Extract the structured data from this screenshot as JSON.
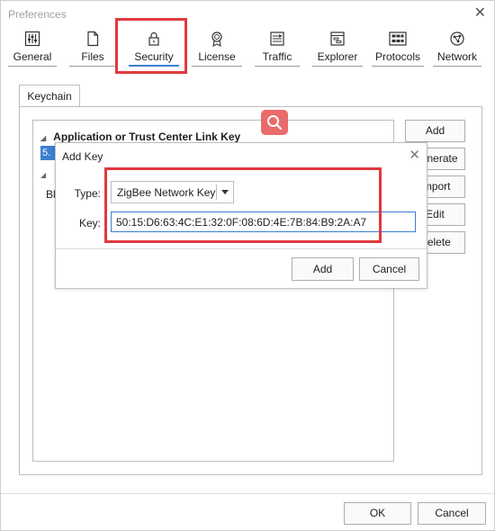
{
  "window": {
    "title": "Preferences"
  },
  "toolbar": [
    {
      "id": "general",
      "label": "General",
      "icon": "sliders-icon"
    },
    {
      "id": "files",
      "label": "Files",
      "icon": "file-icon"
    },
    {
      "id": "security",
      "label": "Security",
      "icon": "lock-icon",
      "active": true
    },
    {
      "id": "license",
      "label": "License",
      "icon": "award-icon"
    },
    {
      "id": "traffic",
      "label": "Traffic",
      "icon": "traffic-icon"
    },
    {
      "id": "explorer",
      "label": "Explorer",
      "icon": "explorer-icon"
    },
    {
      "id": "protocols",
      "label": "Protocols",
      "icon": "protocols-icon"
    },
    {
      "id": "network",
      "label": "Network",
      "icon": "network-icon"
    }
  ],
  "tabs": {
    "keychain": "Keychain"
  },
  "tree": {
    "group1": "Application or Trust Center Link Key",
    "item1_prefix": "5.",
    "item2_prefix": "Bl"
  },
  "side_buttons": {
    "add": "Add",
    "generate": "Generate",
    "import": "Import",
    "edit": "Edit",
    "delete": "Delete"
  },
  "dialog": {
    "title": "Add Key",
    "type_label": "Type:",
    "type_value": "ZigBee Network Key",
    "key_label": "Key:",
    "key_value": "50:15:D6:63:4C:E1:32:0F:08:6D:4E:7B:84:B9:2A:A7",
    "add": "Add",
    "cancel": "Cancel"
  },
  "footer": {
    "ok": "OK",
    "cancel": "Cancel"
  },
  "colors": {
    "accent": "#3b7fd0",
    "highlight": "#e0393d",
    "badge": "#ea6b6b"
  }
}
